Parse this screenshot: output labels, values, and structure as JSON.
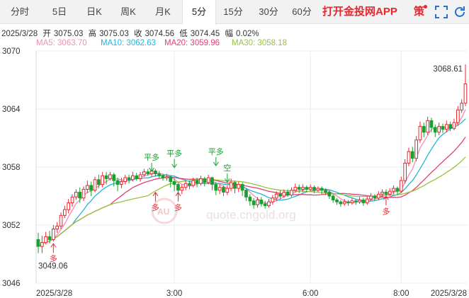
{
  "tabs": [
    {
      "label": "分时",
      "active": false
    },
    {
      "label": "5日",
      "active": false
    },
    {
      "label": "日K",
      "active": false
    },
    {
      "label": "周K",
      "active": false
    },
    {
      "label": "月K",
      "active": false
    },
    {
      "label": "5分",
      "active": true
    },
    {
      "label": "15分",
      "active": false
    },
    {
      "label": "30分",
      "active": false
    },
    {
      "label": "60分",
      "active": false
    }
  ],
  "promo_label": "打开金投网APP",
  "policy_label": "策",
  "icons": [
    "expand-icon",
    "refresh-icon"
  ],
  "ohlc": {
    "date": "2025/3/28",
    "open_label": "开",
    "open": "3075.03",
    "high_label": "高",
    "high": "3075.03",
    "close_label": "收",
    "close": "3074.56",
    "low_label": "低",
    "low": "3074.45",
    "change_label": "幅",
    "change": "0.02%"
  },
  "ma": [
    {
      "label": "MA5: 3063.70",
      "color": "#f08fb8"
    },
    {
      "label": "MA10: 3062.63",
      "color": "#25b4d6"
    },
    {
      "label": "MA20: 3059.96",
      "color": "#e0407a"
    },
    {
      "label": "MA30: 3058.18",
      "color": "#9ac23c"
    }
  ],
  "watermark": "quote.cngold.org",
  "chart_data": {
    "type": "candlestick",
    "y_ticks": [
      3046,
      3052,
      3058,
      3064,
      3070
    ],
    "ylim": [
      3046,
      3070
    ],
    "x_tick_labels": [
      {
        "label": "2025/3/28",
        "index": 0
      },
      {
        "label": "3:00",
        "index": 36
      },
      {
        "label": "6:00",
        "index": 72
      },
      {
        "label": "8:00",
        "index": 96
      },
      {
        "label": "2025/3/28",
        "index": 118
      }
    ],
    "max_label": "3068.61",
    "min_label": "3049.06",
    "up_color": "#e8262f",
    "down_color": "#1a9e2f",
    "candles": [
      [
        3050.5,
        3049.8,
        3051.2,
        3049.1
      ],
      [
        3049.8,
        3050.2,
        3050.9,
        3049.1
      ],
      [
        3050.2,
        3050.8,
        3051.3,
        3050.0
      ],
      [
        3050.8,
        3050.5,
        3051.4,
        3050.1
      ],
      [
        3050.5,
        3051.6,
        3052.0,
        3050.3
      ],
      [
        3051.6,
        3051.9,
        3052.3,
        3051.2
      ],
      [
        3051.9,
        3053.0,
        3053.3,
        3051.6
      ],
      [
        3053.0,
        3053.6,
        3054.0,
        3052.7
      ],
      [
        3053.6,
        3054.3,
        3054.7,
        3053.2
      ],
      [
        3054.3,
        3054.9,
        3055.2,
        3053.9
      ],
      [
        3054.9,
        3055.4,
        3055.7,
        3054.6
      ],
      [
        3055.4,
        3054.8,
        3055.9,
        3054.3
      ],
      [
        3054.8,
        3055.7,
        3056.0,
        3054.5
      ],
      [
        3055.7,
        3056.1,
        3056.6,
        3055.3
      ],
      [
        3056.1,
        3055.6,
        3056.5,
        3055.0
      ],
      [
        3055.6,
        3056.7,
        3057.0,
        3055.4
      ],
      [
        3056.7,
        3056.2,
        3057.2,
        3055.8
      ],
      [
        3056.2,
        3057.1,
        3057.5,
        3055.9
      ],
      [
        3057.1,
        3056.8,
        3057.5,
        3056.2
      ],
      [
        3056.8,
        3057.2,
        3057.5,
        3056.6
      ],
      [
        3057.2,
        3056.6,
        3057.4,
        3056.0
      ],
      [
        3056.6,
        3056.2,
        3056.9,
        3055.5
      ],
      [
        3056.2,
        3056.5,
        3056.9,
        3055.8
      ],
      [
        3056.5,
        3056.9,
        3057.2,
        3056.2
      ],
      [
        3056.9,
        3056.7,
        3057.2,
        3056.3
      ],
      [
        3056.7,
        3057.1,
        3057.5,
        3056.5
      ],
      [
        3057.1,
        3056.8,
        3057.4,
        3056.6
      ],
      [
        3056.8,
        3057.2,
        3057.5,
        3056.5
      ],
      [
        3057.2,
        3057.5,
        3057.8,
        3057.0
      ],
      [
        3057.5,
        3057.3,
        3057.8,
        3057.1
      ],
      [
        3057.3,
        3057.6,
        3057.9,
        3057.0
      ],
      [
        3057.6,
        3057.3,
        3057.8,
        3057.0
      ],
      [
        3057.3,
        3057.1,
        3057.6,
        3056.8
      ],
      [
        3057.1,
        3056.9,
        3057.3,
        3056.6
      ],
      [
        3056.9,
        3057.0,
        3057.3,
        3056.6
      ],
      [
        3057.0,
        3056.5,
        3057.1,
        3055.9
      ],
      [
        3056.5,
        3056.2,
        3056.8,
        3055.5
      ],
      [
        3056.2,
        3055.6,
        3056.4,
        3055.0
      ],
      [
        3055.6,
        3055.9,
        3056.2,
        3055.2
      ],
      [
        3055.9,
        3056.3,
        3056.6,
        3055.6
      ],
      [
        3056.3,
        3056.1,
        3056.6,
        3055.7
      ],
      [
        3056.1,
        3056.6,
        3056.9,
        3055.9
      ],
      [
        3056.6,
        3056.3,
        3056.9,
        3055.9
      ],
      [
        3056.3,
        3056.8,
        3057.1,
        3056.1
      ],
      [
        3056.8,
        3056.4,
        3057.0,
        3056.0
      ],
      [
        3056.4,
        3056.9,
        3057.2,
        3056.2
      ],
      [
        3056.9,
        3056.2,
        3057.0,
        3055.6
      ],
      [
        3056.2,
        3055.6,
        3056.4,
        3055.1
      ],
      [
        3055.6,
        3055.9,
        3056.2,
        3055.2
      ],
      [
        3055.9,
        3055.4,
        3056.1,
        3055.0
      ],
      [
        3055.4,
        3055.8,
        3056.1,
        3055.1
      ],
      [
        3055.8,
        3056.4,
        3056.8,
        3055.5
      ],
      [
        3056.4,
        3055.8,
        3056.6,
        3055.3
      ],
      [
        3055.8,
        3056.2,
        3056.5,
        3055.4
      ],
      [
        3056.2,
        3055.6,
        3056.4,
        3055.0
      ],
      [
        3055.6,
        3054.9,
        3055.8,
        3054.5
      ],
      [
        3054.9,
        3054.5,
        3055.2,
        3054.0
      ],
      [
        3054.5,
        3054.1,
        3054.8,
        3053.7
      ],
      [
        3054.1,
        3054.6,
        3054.9,
        3053.8
      ],
      [
        3054.6,
        3054.2,
        3054.9,
        3053.9
      ],
      [
        3054.2,
        3054.0,
        3054.5,
        3053.7
      ],
      [
        3054.0,
        3054.4,
        3054.7,
        3053.8
      ],
      [
        3054.4,
        3054.8,
        3055.1,
        3054.1
      ],
      [
        3054.8,
        3055.2,
        3055.5,
        3054.5
      ],
      [
        3055.2,
        3055.0,
        3055.6,
        3054.7
      ],
      [
        3055.0,
        3055.4,
        3055.7,
        3054.8
      ],
      [
        3055.4,
        3055.1,
        3055.7,
        3054.9
      ],
      [
        3055.1,
        3055.6,
        3055.9,
        3054.9
      ],
      [
        3055.6,
        3055.9,
        3056.3,
        3055.4
      ],
      [
        3055.9,
        3055.7,
        3056.2,
        3055.3
      ],
      [
        3055.7,
        3055.9,
        3056.2,
        3055.4
      ],
      [
        3055.9,
        3055.7,
        3056.1,
        3055.4
      ],
      [
        3055.7,
        3055.9,
        3056.2,
        3055.5
      ],
      [
        3055.9,
        3055.6,
        3056.1,
        3055.3
      ],
      [
        3055.6,
        3055.8,
        3056.0,
        3055.4
      ],
      [
        3055.8,
        3055.6,
        3056.0,
        3055.2
      ],
      [
        3055.6,
        3055.4,
        3055.8,
        3055.1
      ],
      [
        3055.4,
        3055.0,
        3055.6,
        3054.7
      ],
      [
        3055.0,
        3054.6,
        3055.2,
        3054.3
      ],
      [
        3054.6,
        3054.4,
        3054.8,
        3054.1
      ],
      [
        3054.4,
        3054.2,
        3054.6,
        3053.9
      ],
      [
        3054.2,
        3054.4,
        3054.7,
        3054.0
      ],
      [
        3054.4,
        3054.3,
        3054.6,
        3054.0
      ],
      [
        3054.3,
        3054.5,
        3054.8,
        3054.1
      ],
      [
        3054.5,
        3054.4,
        3054.7,
        3054.1
      ],
      [
        3054.4,
        3054.6,
        3054.9,
        3054.2
      ],
      [
        3054.6,
        3054.3,
        3054.8,
        3054.0
      ],
      [
        3054.3,
        3054.7,
        3055.0,
        3054.1
      ],
      [
        3054.7,
        3055.0,
        3055.3,
        3054.5
      ],
      [
        3055.0,
        3054.8,
        3055.2,
        3054.5
      ],
      [
        3054.8,
        3055.2,
        3055.5,
        3054.6
      ],
      [
        3055.2,
        3055.4,
        3055.7,
        3054.9
      ],
      [
        3055.4,
        3055.2,
        3055.7,
        3054.9
      ],
      [
        3055.2,
        3055.5,
        3055.8,
        3055.0
      ],
      [
        3055.5,
        3055.8,
        3056.1,
        3055.2
      ],
      [
        3055.8,
        3055.5,
        3056.0,
        3055.1
      ],
      [
        3055.5,
        3056.6,
        3057.0,
        3055.3
      ],
      [
        3056.6,
        3058.4,
        3058.8,
        3056.3
      ],
      [
        3058.4,
        3059.6,
        3060.0,
        3058.1
      ],
      [
        3059.6,
        3058.9,
        3060.1,
        3058.5
      ],
      [
        3058.9,
        3060.8,
        3061.2,
        3058.6
      ],
      [
        3060.8,
        3062.2,
        3062.7,
        3060.5
      ],
      [
        3062.2,
        3061.6,
        3062.6,
        3061.1
      ],
      [
        3061.6,
        3062.8,
        3063.2,
        3061.3
      ],
      [
        3062.8,
        3062.1,
        3063.1,
        3061.6
      ],
      [
        3062.1,
        3061.6,
        3062.4,
        3061.1
      ],
      [
        3061.6,
        3062.2,
        3062.6,
        3061.3
      ],
      [
        3062.2,
        3061.9,
        3062.5,
        3061.5
      ],
      [
        3061.9,
        3062.4,
        3062.8,
        3061.6
      ],
      [
        3062.4,
        3062.0,
        3062.7,
        3061.7
      ],
      [
        3062.0,
        3062.6,
        3063.0,
        3061.8
      ],
      [
        3062.6,
        3063.9,
        3064.3,
        3062.3
      ],
      [
        3063.9,
        3064.6,
        3065.0,
        3063.6
      ],
      [
        3064.6,
        3066.6,
        3068.61,
        3064.3
      ]
    ],
    "markers": [
      {
        "index": 30,
        "text": "平多",
        "type": "close-long",
        "price_level": 3057.4
      },
      {
        "index": 36,
        "text": "平多",
        "type": "close-long",
        "price_level": 3057.8
      },
      {
        "index": 47,
        "text": "平多",
        "type": "close-long",
        "price_level": 3058.0
      },
      {
        "index": 50,
        "text": "空",
        "type": "short",
        "price_level": 3056.3
      },
      {
        "index": 31,
        "text": "多",
        "type": "long",
        "price_level": 3055.6
      },
      {
        "index": 37,
        "text": "多",
        "type": "long",
        "price_level": 3055.6
      },
      {
        "index": 4,
        "text": "多",
        "type": "long",
        "price_level": 3050.3
      },
      {
        "index": 92,
        "text": "多",
        "type": "long",
        "price_level": 3055.2
      }
    ]
  }
}
